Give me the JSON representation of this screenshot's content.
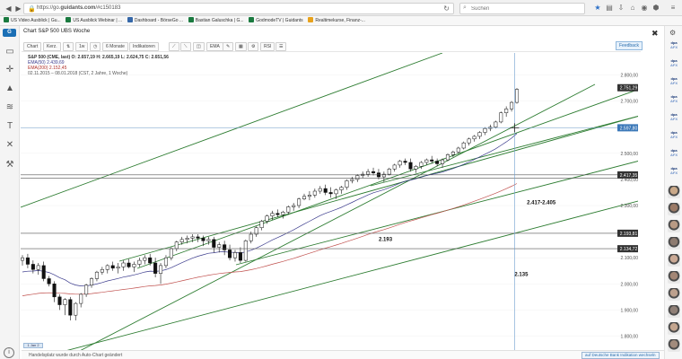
{
  "browser": {
    "url_prefix": "https://go.",
    "url_domain": "guidants.com",
    "url_rest": "/#c150183",
    "search_placeholder": "Suchen",
    "bookmarks": [
      {
        "label": "US Video Ausblick | Gu...",
        "color": "#1a7a3f"
      },
      {
        "label": "US Ausblick Webinar | ...",
        "color": "#1a7a3f"
      },
      {
        "label": "Dashboard - BörseGo ...",
        "color": "#3567a8"
      },
      {
        "label": "Bastian Galuschka | G...",
        "color": "#1a7a3f"
      },
      {
        "label": "GodmodeTV | Guidants",
        "color": "#1a7a3f"
      },
      {
        "label": "Realtimekurse, Finanz-...",
        "color": "#e8a21c"
      }
    ]
  },
  "app": {
    "logo": "G",
    "chart_title": "Chart S&P 500 UBS Woche",
    "toolbar": {
      "chart_btn": "Chart",
      "chart_type": "Kerz.",
      "interval": "1w",
      "period": "6 Monate",
      "indicators": "Indikatoren",
      "ema": "EMA",
      "rsi": "RSI"
    },
    "feedback": "Feedback",
    "legend": {
      "line1": "S&P 500 (CME, last)   O: 2.657,19   H: 2.665,19   L: 2.624,75   C: 2.651,56",
      "ema50": "EMA(50)   2.439,69",
      "ema200": "EMA(200)   2.152,45",
      "range": "02.11.2015 – 08.01.2018   (CST, 2 Jahre, 1 Woche)"
    },
    "status_message": "Handelsplatz wurde durch Auto-Chart geändert",
    "status_link": "auf Deutsche Bank Indikation wechseln",
    "bottom_tag": "1 Jan 2"
  },
  "right_sidebar": {
    "badges": [
      "dpa AFX",
      "dpa AFX",
      "dpa AFX",
      "dpa AFX",
      "dpa AFX",
      "dpa AFX",
      "dpa AFX",
      "dpa AFX"
    ],
    "avatar_colors": [
      "#c9a888",
      "#9b7a66",
      "#b89a84",
      "#8d7b70",
      "#caa995",
      "#a38675",
      "#bca08d",
      "#8f7f76",
      "#c4a690",
      "#a28b7c"
    ]
  },
  "chart_data": {
    "type": "candlestick",
    "title": "Chart S&P 500 UBS Woche",
    "y_axis": {
      "min": 1750,
      "max": 2850,
      "ticks": [
        1800,
        1900,
        2000,
        2100,
        2200,
        2300,
        2400,
        2500,
        2600,
        2700,
        2800
      ],
      "tick_labels": [
        "1.800,00",
        "1.900,00",
        "2.000,00",
        "2.100,00",
        "2.200,00",
        "2.300,00",
        "2.400,00",
        "2.500,00",
        "2.600,00",
        "2.700,00",
        "2.800,00"
      ]
    },
    "x_axis": {
      "start": "2015-11-02",
      "end": "2018-01-08",
      "interval": "1 Woche"
    },
    "price_tags": [
      {
        "label": "2.751,29",
        "value": 2751.29,
        "style": "dark"
      },
      {
        "label": "2.597,80",
        "value": 2597.8,
        "style": "blue"
      },
      {
        "label": "2.417,35",
        "value": 2417.35,
        "style": "dark"
      },
      {
        "label": "2.193,81",
        "value": 2193.81,
        "style": "dark"
      },
      {
        "label": "2.134,72",
        "value": 2134.72,
        "style": "dark"
      }
    ],
    "horizontal_lines": [
      2597.8,
      2417.35,
      2405,
      2193.81,
      2134.72
    ],
    "annotations": [
      {
        "text": "2.417-2.405",
        "x_frac": 0.82,
        "value": 2305
      },
      {
        "text": "2.193",
        "x_frac": 0.58,
        "value": 2165
      },
      {
        "text": "2.135",
        "x_frac": 0.8,
        "value": 2030
      }
    ],
    "crosshair": {
      "x_frac": 0.8,
      "value": 2597.8
    },
    "candles": [
      [
        2090,
        2110,
        2070,
        2100
      ],
      [
        2100,
        2115,
        2060,
        2075
      ],
      [
        2075,
        2090,
        2040,
        2055
      ],
      [
        2055,
        2080,
        2035,
        2070
      ],
      [
        2070,
        2085,
        2010,
        2020
      ],
      [
        2020,
        2030,
        1990,
        2000
      ],
      [
        2000,
        2010,
        1930,
        1950
      ],
      [
        1950,
        1960,
        1900,
        1920
      ],
      [
        1920,
        1945,
        1880,
        1940
      ],
      [
        1940,
        1950,
        1860,
        1880
      ],
      [
        1880,
        1930,
        1860,
        1925
      ],
      [
        1925,
        1965,
        1910,
        1960
      ],
      [
        1960,
        2000,
        1950,
        1995
      ],
      [
        1995,
        2025,
        1985,
        2020
      ],
      [
        2020,
        2050,
        2010,
        2045
      ],
      [
        2045,
        2065,
        2035,
        2055
      ],
      [
        2055,
        2075,
        2040,
        2070
      ],
      [
        2070,
        2085,
        2050,
        2060
      ],
      [
        2060,
        2080,
        2040,
        2065
      ],
      [
        2065,
        2090,
        2050,
        2080
      ],
      [
        2080,
        2095,
        2060,
        2065
      ],
      [
        2065,
        2085,
        2045,
        2075
      ],
      [
        2075,
        2100,
        2065,
        2090
      ],
      [
        2090,
        2110,
        2075,
        2100
      ],
      [
        2100,
        2115,
        2070,
        2080
      ],
      [
        2080,
        2100,
        2025,
        2040
      ],
      [
        2040,
        2080,
        2000,
        2070
      ],
      [
        2070,
        2110,
        2060,
        2100
      ],
      [
        2100,
        2140,
        2090,
        2135
      ],
      [
        2135,
        2165,
        2125,
        2160
      ],
      [
        2160,
        2180,
        2150,
        2170
      ],
      [
        2170,
        2185,
        2155,
        2175
      ],
      [
        2175,
        2190,
        2160,
        2180
      ],
      [
        2180,
        2190,
        2160,
        2175
      ],
      [
        2175,
        2185,
        2145,
        2165
      ],
      [
        2165,
        2180,
        2150,
        2170
      ],
      [
        2170,
        2180,
        2120,
        2140
      ],
      [
        2140,
        2160,
        2120,
        2150
      ],
      [
        2150,
        2165,
        2110,
        2130
      ],
      [
        2130,
        2150,
        2090,
        2100
      ],
      [
        2100,
        2130,
        2085,
        2120
      ],
      [
        2120,
        2140,
        2080,
        2090
      ],
      [
        2090,
        2170,
        2085,
        2165
      ],
      [
        2165,
        2200,
        2155,
        2190
      ],
      [
        2190,
        2220,
        2180,
        2215
      ],
      [
        2215,
        2245,
        2205,
        2240
      ],
      [
        2240,
        2265,
        2230,
        2260
      ],
      [
        2260,
        2280,
        2245,
        2270
      ],
      [
        2270,
        2285,
        2255,
        2265
      ],
      [
        2265,
        2280,
        2250,
        2275
      ],
      [
        2275,
        2300,
        2265,
        2295
      ],
      [
        2295,
        2310,
        2280,
        2300
      ],
      [
        2300,
        2330,
        2290,
        2325
      ],
      [
        2325,
        2345,
        2320,
        2335
      ],
      [
        2335,
        2355,
        2320,
        2340
      ],
      [
        2340,
        2365,
        2330,
        2355
      ],
      [
        2355,
        2375,
        2345,
        2365
      ],
      [
        2365,
        2380,
        2340,
        2350
      ],
      [
        2350,
        2370,
        2330,
        2345
      ],
      [
        2345,
        2365,
        2325,
        2360
      ],
      [
        2360,
        2375,
        2345,
        2370
      ],
      [
        2370,
        2400,
        2360,
        2395
      ],
      [
        2395,
        2410,
        2385,
        2400
      ],
      [
        2400,
        2420,
        2390,
        2415
      ],
      [
        2415,
        2430,
        2405,
        2420
      ],
      [
        2420,
        2440,
        2410,
        2430
      ],
      [
        2430,
        2445,
        2415,
        2425
      ],
      [
        2425,
        2440,
        2400,
        2410
      ],
      [
        2410,
        2430,
        2390,
        2420
      ],
      [
        2420,
        2445,
        2415,
        2440
      ],
      [
        2440,
        2460,
        2430,
        2455
      ],
      [
        2455,
        2475,
        2445,
        2470
      ],
      [
        2470,
        2480,
        2455,
        2465
      ],
      [
        2465,
        2480,
        2430,
        2440
      ],
      [
        2440,
        2455,
        2425,
        2450
      ],
      [
        2450,
        2470,
        2440,
        2465
      ],
      [
        2465,
        2480,
        2455,
        2475
      ],
      [
        2475,
        2490,
        2460,
        2470
      ],
      [
        2470,
        2480,
        2450,
        2460
      ],
      [
        2460,
        2480,
        2445,
        2475
      ],
      [
        2475,
        2500,
        2470,
        2495
      ],
      [
        2495,
        2510,
        2485,
        2505
      ],
      [
        2505,
        2525,
        2500,
        2520
      ],
      [
        2520,
        2545,
        2515,
        2540
      ],
      [
        2540,
        2560,
        2530,
        2555
      ],
      [
        2555,
        2570,
        2545,
        2565
      ],
      [
        2565,
        2585,
        2555,
        2580
      ],
      [
        2580,
        2600,
        2570,
        2595
      ],
      [
        2595,
        2610,
        2585,
        2600
      ],
      [
        2600,
        2625,
        2595,
        2620
      ],
      [
        2620,
        2660,
        2615,
        2655
      ],
      [
        2655,
        2680,
        2640,
        2670
      ],
      [
        2670,
        2700,
        2660,
        2695
      ],
      [
        2695,
        2750,
        2690,
        2745
      ]
    ],
    "series": [
      {
        "name": "EMA(50)",
        "color": "#3a3a8c",
        "value_last": 2439.69
      },
      {
        "name": "EMA(200)",
        "color": "#c0504d",
        "value_last": 2152.45
      }
    ]
  }
}
